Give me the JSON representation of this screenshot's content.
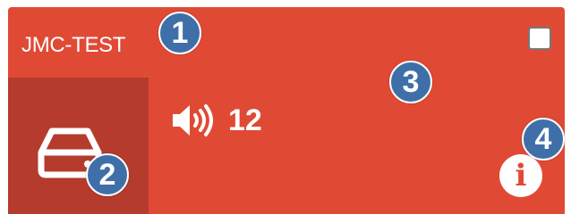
{
  "device": {
    "name": "JMC-TEST",
    "volume": "12",
    "info_glyph": "i",
    "icon": "drive-icon",
    "colors": {
      "card": "#e04a35",
      "icon_panel": "#b53b2c",
      "badge": "#3f6fa8"
    }
  },
  "badges": [
    "1",
    "2",
    "3",
    "4"
  ]
}
